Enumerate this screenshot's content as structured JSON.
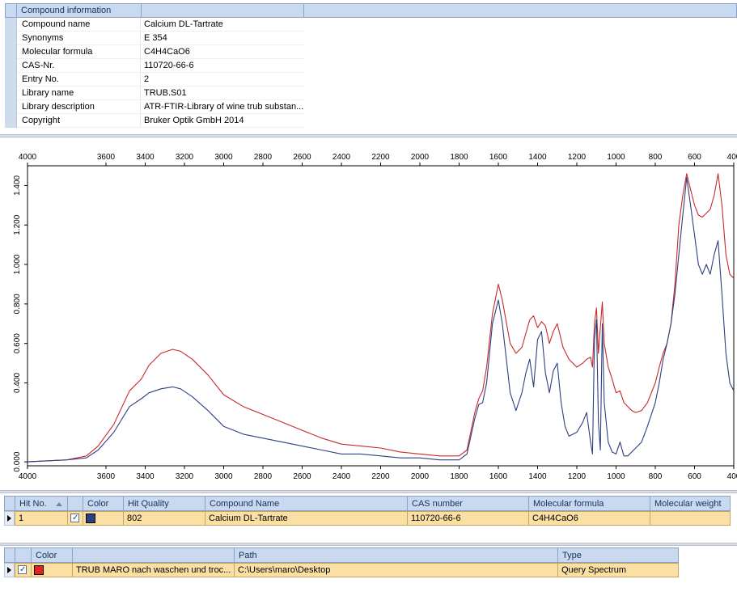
{
  "compound_info": {
    "header": "Compound information",
    "rows": [
      {
        "label": "Compound name",
        "value": "Calcium DL-Tartrate"
      },
      {
        "label": "Synonyms",
        "value": "E 354"
      },
      {
        "label": "Molecular formula",
        "value": "C4H4CaO6"
      },
      {
        "label": "CAS-Nr.",
        "value": "110720-66-6"
      },
      {
        "label": "Entry No.",
        "value": "2"
      },
      {
        "label": "Library name",
        "value": "TRUB.S01"
      },
      {
        "label": "Library description",
        "value": "ATR-FTIR-Library of wine trub substan..."
      },
      {
        "label": "Copyright",
        "value": "Bruker Optik GmbH 2014"
      }
    ]
  },
  "chart_data": {
    "type": "line",
    "x_ticks": [
      "4000",
      "3600",
      "3400",
      "3200",
      "3000",
      "2800",
      "2600",
      "2400",
      "2200",
      "2000",
      "1800",
      "1600",
      "1400",
      "1200",
      "1000",
      "800",
      "600",
      "400"
    ],
    "x_tick_values": [
      4000,
      3600,
      3400,
      3200,
      3000,
      2800,
      2600,
      2400,
      2200,
      2000,
      1800,
      1600,
      1400,
      1200,
      1000,
      800,
      600,
      400
    ],
    "y_ticks": [
      "0.000",
      "0.400",
      "0.600",
      "0.800",
      "1.000",
      "1.200",
      "1.400"
    ],
    "y_tick_values": [
      0.0,
      0.4,
      0.6,
      0.8,
      1.0,
      1.2,
      1.4
    ],
    "xlim": [
      4000,
      400
    ],
    "ylim": [
      -0.02,
      1.5
    ],
    "x_reversed": true,
    "series": [
      {
        "color": "#c62a2a",
        "points": [
          [
            4000,
            0.0
          ],
          [
            3800,
            0.01
          ],
          [
            3700,
            0.03
          ],
          [
            3640,
            0.08
          ],
          [
            3560,
            0.19
          ],
          [
            3480,
            0.36
          ],
          [
            3420,
            0.42
          ],
          [
            3380,
            0.49
          ],
          [
            3320,
            0.55
          ],
          [
            3260,
            0.57
          ],
          [
            3220,
            0.56
          ],
          [
            3160,
            0.52
          ],
          [
            3080,
            0.44
          ],
          [
            3000,
            0.34
          ],
          [
            2900,
            0.28
          ],
          [
            2800,
            0.24
          ],
          [
            2700,
            0.2
          ],
          [
            2600,
            0.16
          ],
          [
            2500,
            0.12
          ],
          [
            2400,
            0.09
          ],
          [
            2300,
            0.08
          ],
          [
            2200,
            0.07
          ],
          [
            2100,
            0.05
          ],
          [
            2000,
            0.04
          ],
          [
            1900,
            0.03
          ],
          [
            1800,
            0.03
          ],
          [
            1760,
            0.06
          ],
          [
            1720,
            0.25
          ],
          [
            1700,
            0.32
          ],
          [
            1680,
            0.36
          ],
          [
            1660,
            0.48
          ],
          [
            1630,
            0.75
          ],
          [
            1600,
            0.9
          ],
          [
            1580,
            0.82
          ],
          [
            1540,
            0.6
          ],
          [
            1510,
            0.55
          ],
          [
            1480,
            0.58
          ],
          [
            1440,
            0.72
          ],
          [
            1420,
            0.74
          ],
          [
            1400,
            0.68
          ],
          [
            1380,
            0.71
          ],
          [
            1360,
            0.69
          ],
          [
            1340,
            0.6
          ],
          [
            1320,
            0.66
          ],
          [
            1300,
            0.7
          ],
          [
            1270,
            0.58
          ],
          [
            1240,
            0.52
          ],
          [
            1200,
            0.48
          ],
          [
            1170,
            0.5
          ],
          [
            1150,
            0.52
          ],
          [
            1130,
            0.53
          ],
          [
            1120,
            0.48
          ],
          [
            1110,
            0.7
          ],
          [
            1100,
            0.78
          ],
          [
            1090,
            0.55
          ],
          [
            1070,
            0.81
          ],
          [
            1060,
            0.6
          ],
          [
            1040,
            0.48
          ],
          [
            1020,
            0.42
          ],
          [
            1000,
            0.35
          ],
          [
            980,
            0.36
          ],
          [
            960,
            0.3
          ],
          [
            940,
            0.28
          ],
          [
            920,
            0.26
          ],
          [
            900,
            0.25
          ],
          [
            870,
            0.26
          ],
          [
            840,
            0.3
          ],
          [
            800,
            0.4
          ],
          [
            780,
            0.48
          ],
          [
            760,
            0.55
          ],
          [
            740,
            0.6
          ],
          [
            720,
            0.7
          ],
          [
            700,
            0.9
          ],
          [
            680,
            1.2
          ],
          [
            660,
            1.35
          ],
          [
            640,
            1.46
          ],
          [
            620,
            1.38
          ],
          [
            600,
            1.3
          ],
          [
            580,
            1.25
          ],
          [
            560,
            1.24
          ],
          [
            540,
            1.26
          ],
          [
            520,
            1.28
          ],
          [
            500,
            1.35
          ],
          [
            480,
            1.46
          ],
          [
            460,
            1.3
          ],
          [
            440,
            1.05
          ],
          [
            420,
            0.95
          ],
          [
            400,
            0.93
          ]
        ]
      },
      {
        "color": "#2f3f82",
        "points": [
          [
            4000,
            0.0
          ],
          [
            3800,
            0.01
          ],
          [
            3700,
            0.02
          ],
          [
            3640,
            0.06
          ],
          [
            3560,
            0.15
          ],
          [
            3480,
            0.28
          ],
          [
            3420,
            0.32
          ],
          [
            3380,
            0.35
          ],
          [
            3320,
            0.37
          ],
          [
            3260,
            0.38
          ],
          [
            3220,
            0.37
          ],
          [
            3160,
            0.33
          ],
          [
            3080,
            0.26
          ],
          [
            3000,
            0.18
          ],
          [
            2900,
            0.14
          ],
          [
            2800,
            0.12
          ],
          [
            2700,
            0.1
          ],
          [
            2600,
            0.08
          ],
          [
            2500,
            0.06
          ],
          [
            2400,
            0.04
          ],
          [
            2300,
            0.04
          ],
          [
            2200,
            0.03
          ],
          [
            2100,
            0.02
          ],
          [
            2000,
            0.02
          ],
          [
            1900,
            0.01
          ],
          [
            1800,
            0.01
          ],
          [
            1760,
            0.04
          ],
          [
            1720,
            0.22
          ],
          [
            1700,
            0.29
          ],
          [
            1680,
            0.3
          ],
          [
            1660,
            0.4
          ],
          [
            1630,
            0.7
          ],
          [
            1600,
            0.82
          ],
          [
            1580,
            0.7
          ],
          [
            1540,
            0.35
          ],
          [
            1510,
            0.26
          ],
          [
            1480,
            0.35
          ],
          [
            1460,
            0.45
          ],
          [
            1440,
            0.52
          ],
          [
            1420,
            0.38
          ],
          [
            1400,
            0.62
          ],
          [
            1380,
            0.66
          ],
          [
            1360,
            0.45
          ],
          [
            1340,
            0.35
          ],
          [
            1320,
            0.46
          ],
          [
            1300,
            0.5
          ],
          [
            1280,
            0.3
          ],
          [
            1260,
            0.18
          ],
          [
            1240,
            0.13
          ],
          [
            1200,
            0.15
          ],
          [
            1170,
            0.2
          ],
          [
            1150,
            0.25
          ],
          [
            1130,
            0.1
          ],
          [
            1120,
            0.04
          ],
          [
            1110,
            0.62
          ],
          [
            1100,
            0.72
          ],
          [
            1090,
            0.2
          ],
          [
            1080,
            0.06
          ],
          [
            1070,
            0.7
          ],
          [
            1060,
            0.3
          ],
          [
            1040,
            0.1
          ],
          [
            1020,
            0.05
          ],
          [
            1000,
            0.04
          ],
          [
            980,
            0.1
          ],
          [
            960,
            0.03
          ],
          [
            940,
            0.03
          ],
          [
            920,
            0.05
          ],
          [
            900,
            0.07
          ],
          [
            870,
            0.1
          ],
          [
            840,
            0.18
          ],
          [
            800,
            0.3
          ],
          [
            780,
            0.4
          ],
          [
            760,
            0.52
          ],
          [
            740,
            0.6
          ],
          [
            720,
            0.7
          ],
          [
            700,
            0.85
          ],
          [
            680,
            1.05
          ],
          [
            660,
            1.25
          ],
          [
            640,
            1.44
          ],
          [
            620,
            1.3
          ],
          [
            600,
            1.15
          ],
          [
            580,
            1.0
          ],
          [
            560,
            0.95
          ],
          [
            540,
            1.0
          ],
          [
            520,
            0.95
          ],
          [
            500,
            1.05
          ],
          [
            480,
            1.12
          ],
          [
            460,
            0.85
          ],
          [
            440,
            0.55
          ],
          [
            420,
            0.4
          ],
          [
            400,
            0.36
          ]
        ]
      }
    ]
  },
  "hit_table": {
    "columns": [
      "Hit No.",
      "Color",
      "Hit Quality",
      "Compound Name",
      "CAS number",
      "Molecular formula",
      "Molecular weight"
    ],
    "sort_icon": "sort-ascending-icon",
    "rows": [
      {
        "hit_no": "1",
        "color": "#2f3f82",
        "quality": "802",
        "name": "Calcium DL-Tartrate",
        "cas": "110720-66-6",
        "formula": "C4H4CaO6",
        "weight": ""
      }
    ]
  },
  "query_table": {
    "columns": [
      "Color",
      "Path",
      "Type"
    ],
    "rows": [
      {
        "name": "TRUB MARO nach waschen und troc...",
        "color": "#e3241e",
        "path": "C:\\Users\\maro\\Desktop",
        "type": "Query Spectrum"
      }
    ]
  }
}
